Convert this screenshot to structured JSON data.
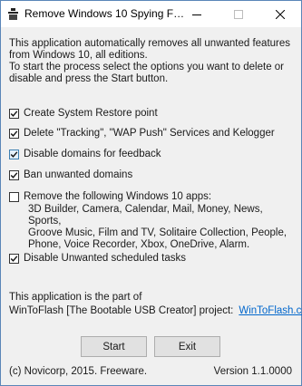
{
  "window": {
    "title": "Remove Windows 10 Spying F…",
    "icon": "app-icon"
  },
  "intro": {
    "line1": "This application automatically removes all unwanted features",
    "line2": "from Windows 10, all editions.",
    "line3": "To start the process select the options you want to delete or",
    "line4": "disable and press the Start button."
  },
  "options": [
    {
      "label": "Create System Restore point",
      "checked": true
    },
    {
      "label": "Delete \"Tracking\", \"WAP Push\" Services and Kelogger",
      "checked": true
    },
    {
      "label": "Disable domains for feedback",
      "checked": true
    },
    {
      "label": "Ban unwanted domains",
      "checked": true
    },
    {
      "label": "Remove the following Windows 10 apps:",
      "checked": false
    },
    {
      "label": "Disable Unwanted scheduled tasks",
      "checked": true
    }
  ],
  "apps": {
    "line1": "3D Builder, Camera, Calendar, Mail, Money, News, Sports,",
    "line2": "Groove Music, Film and TV, Solitaire Collection, People,",
    "line3": "Phone, Voice Recorder, Xbox, OneDrive, Alarm."
  },
  "footer": {
    "part_of": "This application is the part of",
    "project": "WinToFlash [The Bootable USB Creator] project:",
    "link": "WinToFlash.com",
    "copyright": "(c) Novicorp, 2015. Freeware.",
    "version": "Version 1.1.0000"
  },
  "buttons": {
    "start": "Start",
    "exit": "Exit"
  }
}
